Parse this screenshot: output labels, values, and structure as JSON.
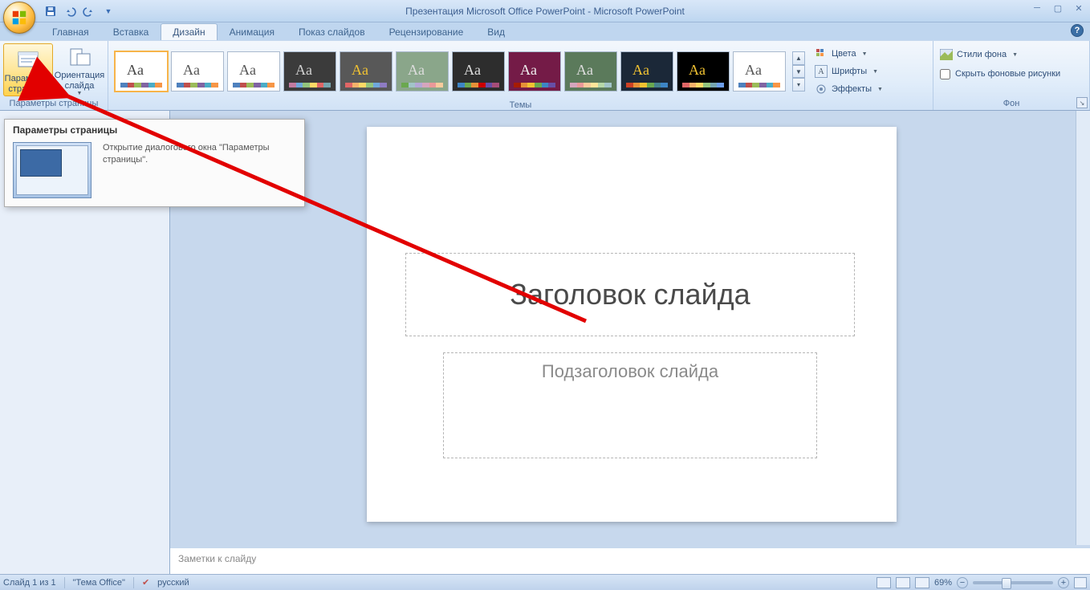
{
  "title_bar": {
    "doc_title": "Презентация Microsoft Office PowerPoint - Microsoft PowerPoint"
  },
  "tabs": {
    "home": "Главная",
    "insert": "Вставка",
    "design": "Дизайн",
    "animation": "Анимация",
    "slideshow": "Показ слайдов",
    "review": "Рецензирование",
    "view": "Вид"
  },
  "ribbon": {
    "page_setup_group": {
      "label": "Параметры страницы",
      "page_setup_btn": "Параметры\nстраницы",
      "orientation_btn": "Ориентация\nслайда"
    },
    "themes_group": {
      "label": "Темы"
    },
    "theme_options": {
      "colors": "Цвета",
      "fonts": "Шрифты",
      "effects": "Эффекты"
    },
    "background_group": {
      "label": "Фон",
      "styles": "Стили фона",
      "hide_graphics": "Скрыть фоновые рисунки"
    }
  },
  "tooltip": {
    "title": "Параметры страницы",
    "desc": "Открытие диалогового окна \"Параметры страницы\"."
  },
  "slide": {
    "title_placeholder": "Заголовок слайда",
    "subtitle_placeholder": "Подзаголовок слайда"
  },
  "notes": {
    "placeholder": "Заметки к слайду"
  },
  "status": {
    "slide_count": "Слайд 1 из 1",
    "theme": "\"Тема Office\"",
    "language": "русский",
    "zoom": "69%"
  },
  "palettes": [
    [
      "#4f81bd",
      "#c0504d",
      "#9bbb59",
      "#8064a2",
      "#4bacc6",
      "#f79646"
    ],
    [
      "#4f81bd",
      "#c0504d",
      "#9bbb59",
      "#8064a2",
      "#4bacc6",
      "#f79646"
    ],
    [
      "#4f81bd",
      "#c0504d",
      "#9bbb59",
      "#8064a2",
      "#4bacc6",
      "#f79646"
    ],
    [
      "#c27ba0",
      "#6fa8dc",
      "#93c47d",
      "#ffd966",
      "#e06666",
      "#76a5af"
    ],
    [
      "#e06666",
      "#f6b26b",
      "#ffd966",
      "#93c47d",
      "#6fa8dc",
      "#8e7cc3"
    ],
    [
      "#6aa84f",
      "#a2c4c9",
      "#b4a7d6",
      "#d5a6bd",
      "#ea9999",
      "#f9cb9c"
    ],
    [
      "#3d85c6",
      "#6aa84f",
      "#e69138",
      "#cc0000",
      "#674ea7",
      "#a64d79"
    ],
    [
      "#a61c00",
      "#e69138",
      "#f1c232",
      "#6aa84f",
      "#3d85c6",
      "#674ea7"
    ],
    [
      "#d5a6bd",
      "#ea9999",
      "#f9cb9c",
      "#ffe599",
      "#b6d7a8",
      "#a2c4c9"
    ],
    [
      "#cc4125",
      "#e69138",
      "#f1c232",
      "#6aa84f",
      "#45818e",
      "#3d85c6"
    ],
    [
      "#e06666",
      "#f6b26b",
      "#ffd966",
      "#93c47d",
      "#76a5af",
      "#6d9eeb"
    ],
    [
      "#4f81bd",
      "#c0504d",
      "#9bbb59",
      "#8064a2",
      "#4bacc6",
      "#f79646"
    ]
  ],
  "theme_bgs": [
    "#ffffff",
    "#ffffff",
    "#ffffff",
    "#3b3b3b",
    "#585858",
    "#8aa68a",
    "#2d2d2d",
    "#741b47",
    "#5b7a5b",
    "#1b2838",
    "#000000",
    "#ffffff"
  ],
  "theme_fgs": [
    "#444444",
    "#555555",
    "#555555",
    "#d0d0d0",
    "#f1c232",
    "#dddddd",
    "#dddddd",
    "#eeeeee",
    "#dddddd",
    "#f1c232",
    "#f1c232",
    "#555555"
  ]
}
